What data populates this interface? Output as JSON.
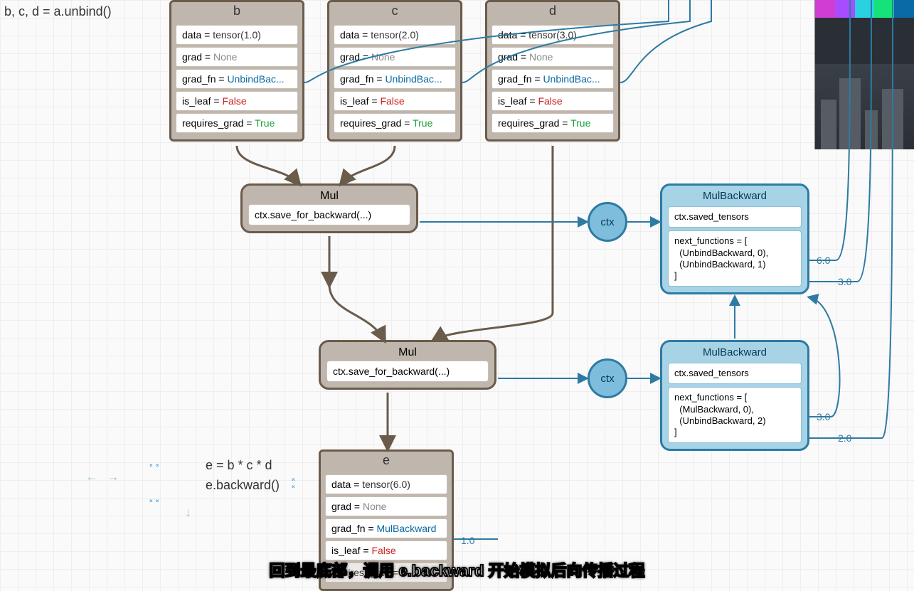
{
  "code": {
    "unbind": "b, c, d = a.unbind()",
    "expr": "e = b * c * d",
    "back": "e.backward()"
  },
  "tensors": {
    "b": {
      "title": "b",
      "data_key": "data = ",
      "data_val": "tensor(1.0)",
      "grad_key": "grad = ",
      "grad_val": "None",
      "fn_key": "grad_fn = ",
      "fn_val": "UnbindBac...",
      "leaf_key": "is_leaf = ",
      "leaf_val": "False",
      "req_key": "requires_grad = ",
      "req_val": "True"
    },
    "c": {
      "title": "c",
      "data_key": "data = ",
      "data_val": "tensor(2.0)",
      "grad_key": "grad = ",
      "grad_val": "None",
      "fn_key": "grad_fn = ",
      "fn_val": "UnbindBac...",
      "leaf_key": "is_leaf = ",
      "leaf_val": "False",
      "req_key": "requires_grad = ",
      "req_val": "True"
    },
    "d": {
      "title": "d",
      "data_key": "data = ",
      "data_val": "tensor(3.0)",
      "grad_key": "grad = ",
      "grad_val": "None",
      "fn_key": "grad_fn = ",
      "fn_val": "UnbindBac...",
      "leaf_key": "is_leaf = ",
      "leaf_val": "False",
      "req_key": "requires_grad = ",
      "req_val": "True"
    },
    "e": {
      "title": "e",
      "data_key": "data = ",
      "data_val": "tensor(6.0)",
      "grad_key": "grad = ",
      "grad_val": "None",
      "fn_key": "grad_fn = ",
      "fn_val": "MulBackward",
      "leaf_key": "is_leaf = ",
      "leaf_val": "False",
      "req_key_partial": "equires_grad = "
    }
  },
  "ops": {
    "mul1": {
      "title": "Mul",
      "body": "ctx.save_for_backward(...)"
    },
    "mul2": {
      "title": "Mul",
      "body": "ctx.save_for_backward(...)"
    }
  },
  "ctx": {
    "label": "ctx"
  },
  "backward": {
    "mul1": {
      "title": "MulBackward",
      "row1": "ctx.saved_tensors",
      "row2": "next_functions = [\n  (UnbindBackward, 0),\n  (UnbindBackward, 1)\n]"
    },
    "mul2": {
      "title": "MulBackward",
      "row1": "ctx.saved_tensors",
      "row2": "next_functions = [\n  (MulBackward, 0),\n  (UnbindBackward, 2)\n]"
    }
  },
  "edge_labels": {
    "bwd1_a": "6.0",
    "bwd1_b": "3.0",
    "bwd2_a": "3.0",
    "bwd2_b": "2.0",
    "e_out": "1.0"
  },
  "subtitle": "回到最底部，调用 e.backward 开始模拟后向传播过程",
  "colors": {
    "brown": "#6b5b4b",
    "tan": "#bfb6ad",
    "blue": "#2e7aa3",
    "blue_fill": "#a7d3e6",
    "none": "#8a8a8a",
    "link_blue": "#0a6aa5",
    "false": "#c22",
    "true": "#169f3c"
  }
}
